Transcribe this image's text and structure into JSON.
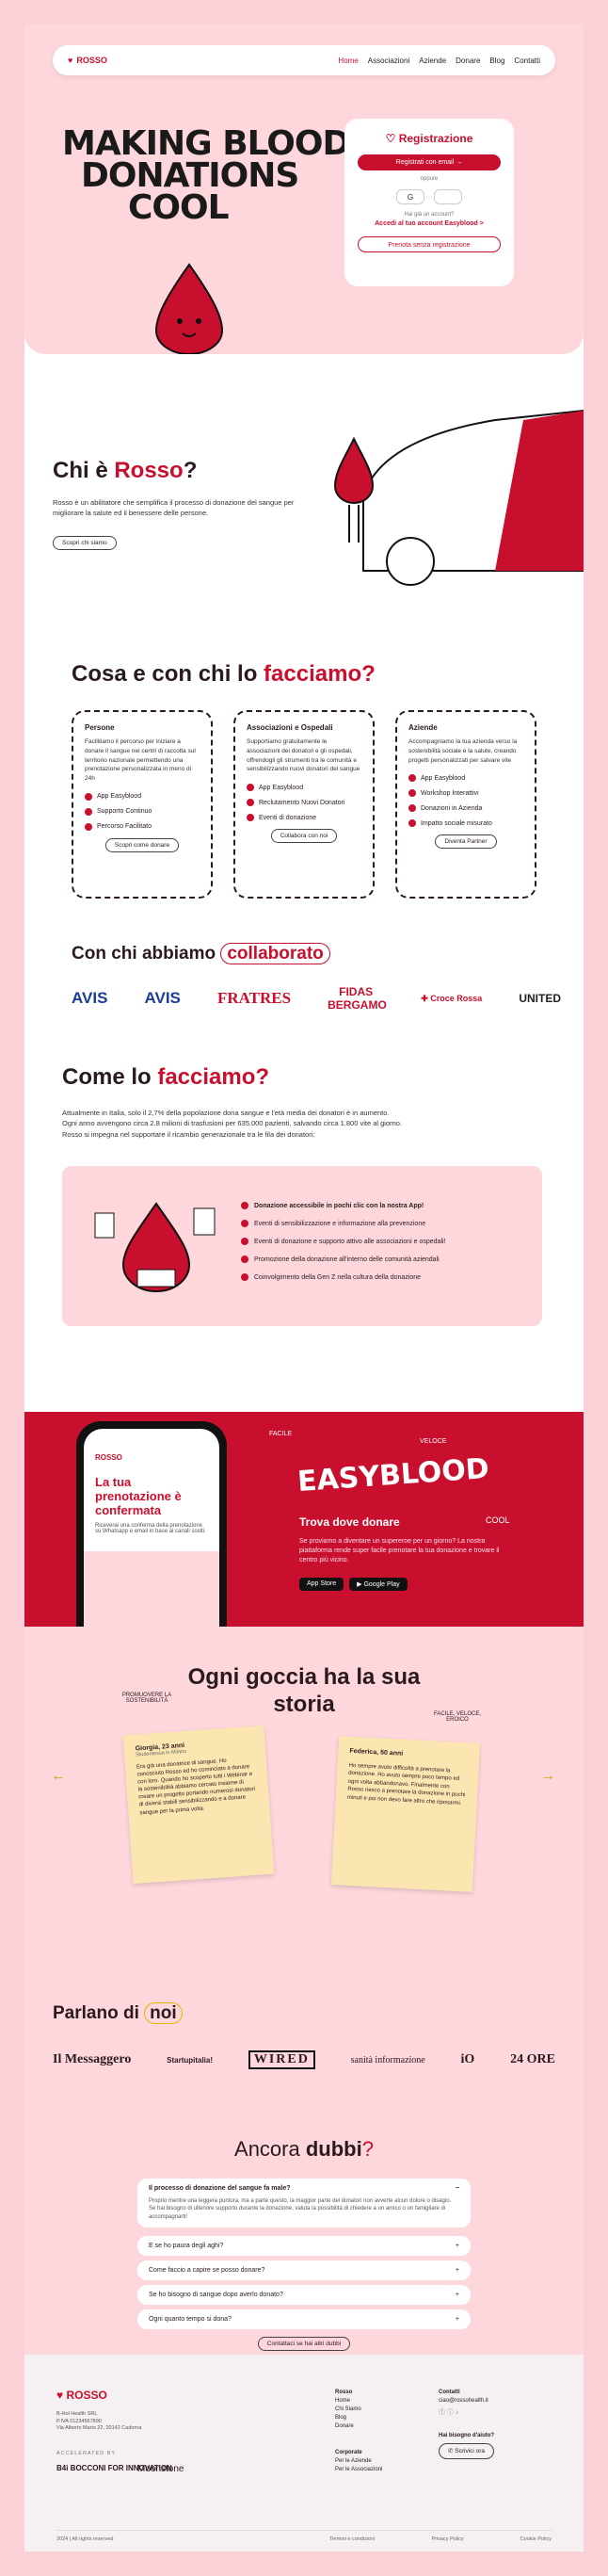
{
  "brand": "ROSSO",
  "nav": [
    "Home",
    "Associazioni",
    "Aziende",
    "Donare",
    "Blog",
    "Contatti"
  ],
  "hero": {
    "headline_1": "MAKING BLOOD",
    "headline_2": "DONATIONS",
    "headline_3": "COOL"
  },
  "register": {
    "title": "Registrazione",
    "email_btn": "Registrati con email →",
    "or": "oppure",
    "have_account": "Hai già un account?",
    "login": "Accedi al tuo account Easyblood >",
    "skip": "Prenota senza registrazione"
  },
  "about": {
    "title_a": "Chi è ",
    "title_b": "Rosso",
    "title_c": "?",
    "body": "Rosso è un abilitatore che semplifica il processo di donazione del sangue per migliorare la salute ed il benessere delle persone.",
    "btn": "Scopri chi siamo"
  },
  "what": {
    "title_a": "Cosa e con chi lo ",
    "title_b": "facciamo?"
  },
  "cards": [
    {
      "title": "Persone",
      "body": "Facilitiamo il percorso per iniziare a donare il sangue nei centri di raccolta sul territorio nazionale permettendo una prenotazione personalizzata in meno di 24h",
      "items": [
        "App Easyblood",
        "Supporto Continuo",
        "Percorso Facilitato"
      ],
      "btn": "Scopri come donare"
    },
    {
      "title": "Associazioni e Ospedali",
      "body": "Supportiamo gratuitamente le associazioni dei donatori e gli ospedali, offrendogli gli strumenti tra le comunità e sensibilizzando nuovi donatori del sangue",
      "items": [
        "App Easyblood",
        "Reclutamento Nuovi Donatori",
        "Eventi di donazione"
      ],
      "btn": "Collabora con noi"
    },
    {
      "title": "Aziende",
      "body": "Accompagniamo la tua azienda verso la sostenibilità sociale e la salute, creando progetti personalizzati per salvare vite",
      "items": [
        "App Easyblood",
        "Workshop Interattivi",
        "Donazioni in Azienda",
        "Impatto sociale misurato"
      ],
      "btn": "Diventa Partner"
    }
  ],
  "collab": {
    "title_a": "Con chi abbiamo ",
    "title_b": "collaborato",
    "logos": [
      "AVIS",
      "AVIS",
      "FRATRES",
      "FIDAS BERGAMO",
      "Croce Rossa",
      "UNITED"
    ]
  },
  "how": {
    "title_a": "Come lo ",
    "title_b": "facciamo?",
    "p1": "Attualmente in Italia, solo il 2,7% della popolazione dona sangue e l'età media dei donatori è in aumento.",
    "p2": "Ogni anno avvengono circa 2.8 milioni di trasfusioni per 635.000 pazienti, salvando circa 1.800 vite al giorno.",
    "p3": "Rosso si impegna nel supportare il ricambio generazionale tra le fila dei donatori:",
    "items": [
      "Donazione accessibile in pochi clic con la nostra App!",
      "Eventi di sensibilizzazione e informazione alla prevenzione",
      "Eventi di donazione e supporto attivo alle associazioni e ospedali!",
      "Promozione della donazione all'interno delle comunità aziendali",
      "Coinvolgimento della Gen Z nella cultura della donazione"
    ]
  },
  "easyblood": {
    "screen_title": "La tua prenotazione è confermata",
    "screen_body": "Riceverai una conferma della prenotazione su Whatsapp e email in base ai canali scelti.",
    "word": "EASYBLOOD",
    "facile": "FACILE",
    "veloce": "VELOCE",
    "cool": "COOL",
    "subtitle": "Trova dove donare",
    "body": "Se proviamo a diventare un supereroe per un giorno? La nostra piattaforma rende super facile prenotare la tua donazione e trovare il centro più vicino.",
    "appstore": "App Store",
    "gplay": "Google Play"
  },
  "stories": {
    "title_1": "Ogni goccia ha la sua",
    "title_2": "storia",
    "tag1": "PROMUOVERE LA SOSTENIBILITÀ",
    "tag2": "FACILE, VELOCE, EROICO",
    "s1_name": "Giorgia, 23 anni",
    "s1_meta": "Studentessa in Milano",
    "s1_text": "Era già una donatrice di sangue. Ho conosciuto Rosso ed ho cominciato a donare con loro. Quando ho scoperto tutti i Webinar e la sostenibilità abbiamo cercato insieme di creare un progetto portando numerosi donatori di diversi stabili sensibilizzando e a donare sangue per la prima volta.",
    "s2_name": "Federica, 50 anni",
    "s2_text": "Ho sempre avuto difficoltà a prenotare la donazione. Ho avuto sempre poco tempo ed ogni volta abbandonavo. Finalmente con Rosso riesco a prenotare la donazione in pochi minuti e poi non devo fare altro che riposarmi."
  },
  "press": {
    "title_a": "Parlano di ",
    "title_b": "noi",
    "logos": [
      "Il Messaggero",
      "Startupitalia!",
      "WIRED",
      "sanità informazione",
      "iO",
      "24 ORE"
    ]
  },
  "faq": {
    "title_a": "Ancora ",
    "title_b": "dubbi",
    "title_c": "?",
    "open_q": "Il processo di donazione del sangue fa male?",
    "open_a": "Proprio mentre una leggera puntura, ma a parte questo, la maggior parte dei donatori non avverte alcun dolore o disagio. Se hai bisogno di ulteriore supporto durante la donazione, valuta la possibilità di chiedere a un amico o un famigliare di accompagnarti!",
    "q": [
      "E se ho paura degli aghi?",
      "Come faccio a capire se posso donare?",
      "Se ho bisogno di sangue dopo averlo donato?",
      "Ogni quanto tempo si dona?"
    ],
    "btn": "Contattaci se hai altri dubbi"
  },
  "footer": {
    "address": "B-Hol Health SRL\nP.IVA 01234567890\nVia Alberto Mario 22, 20142 Cadorna",
    "accel": "ACCELERATED BY",
    "b4i": "B4i BOCCONI FOR INNOVATION",
    "moonstone": "Moonstone",
    "col1_title": "Rosso",
    "col1": [
      "Home",
      "Chi Siamo",
      "Blog",
      "Donare"
    ],
    "col2_title": "Corporate",
    "col2": [
      "Per le Aziende",
      "Per le Associazioni"
    ],
    "col3_title": "Contatti",
    "email": "ciao@rossohealth.it",
    "help": "Hai bisogno d'aiuto?",
    "whatsapp": "Scrivici ora",
    "copy": "2024 | All rights reserved",
    "t1": "Termini e condizioni",
    "t2": "Privacy Policy",
    "t3": "Cookie Policy"
  }
}
